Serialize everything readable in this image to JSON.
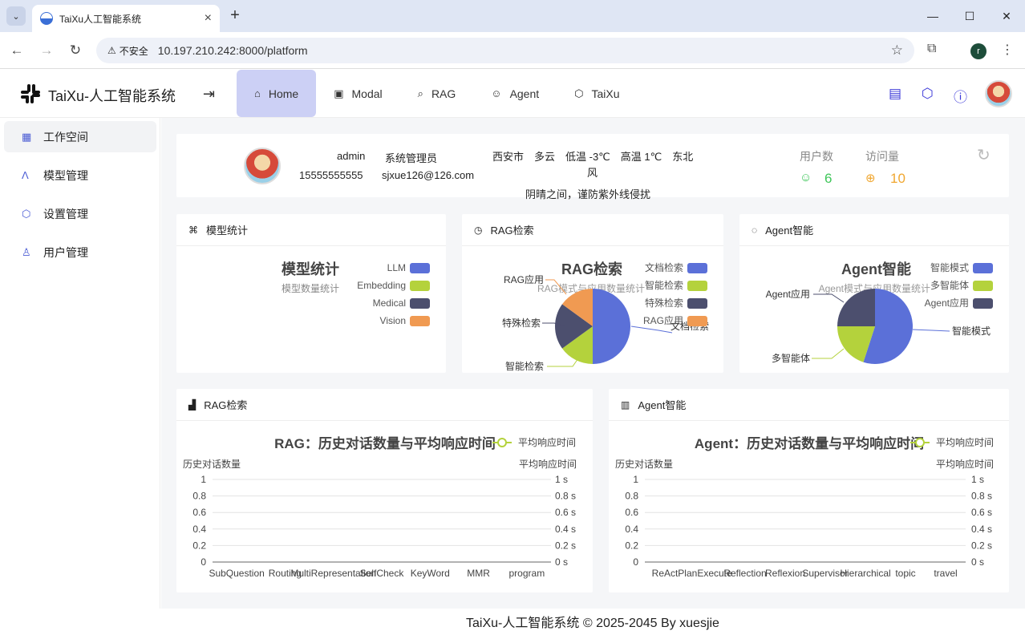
{
  "browser": {
    "tab_title": "TaiXu人工智能系统",
    "insecure_label": "不安全",
    "url": "10.197.210.242:8000/platform",
    "profile_initial": "r"
  },
  "header": {
    "brand": "TaiXu-人工智能系统",
    "nav": [
      {
        "label": "Home",
        "icon": "home-icon"
      },
      {
        "label": "Modal",
        "icon": "image-edit-icon"
      },
      {
        "label": "RAG",
        "icon": "search-doc-icon"
      },
      {
        "label": "Agent",
        "icon": "robot-icon"
      },
      {
        "label": "TaiXu",
        "icon": "cube-icon"
      }
    ]
  },
  "sidebar": {
    "items": [
      {
        "label": "工作空间",
        "icon": "workspace-icon"
      },
      {
        "label": "模型管理",
        "icon": "model-icon"
      },
      {
        "label": "设置管理",
        "icon": "settings-icon"
      },
      {
        "label": "用户管理",
        "icon": "user-icon"
      }
    ]
  },
  "user_card": {
    "name": "admin",
    "role": "系统管理员",
    "phone": "15555555555",
    "email": "sjxue126@126.com",
    "weather_line1": "西安市　多云　低温 -3℃　高温 1℃　东北",
    "weather_line2": "风",
    "weather_tip": "阴晴之间，谨防紫外线侵扰",
    "users_label": "用户数",
    "users_value": "6",
    "visits_label": "访问量",
    "visits_value": "10"
  },
  "model_card": {
    "header": "模型统计",
    "title": "模型统计",
    "subtitle": "模型数量统计",
    "legend": [
      "LLM",
      "Embedding",
      "Medical",
      "Vision"
    ]
  },
  "rag_card": {
    "header": "RAG检索",
    "title": "RAG检索",
    "subtitle": "RAG模式与应用数量统计",
    "legend": [
      "文档检索",
      "智能检索",
      "特殊检索",
      "RAG应用"
    ],
    "slice_labels": [
      "文档检索",
      "智能检索",
      "特殊检索",
      "RAG应用"
    ]
  },
  "agent_card": {
    "header": "Agent智能",
    "title": "Agent智能",
    "subtitle": "Agent模式与应用数量统计",
    "legend": [
      "智能模式",
      "多智能体",
      "Agent应用"
    ],
    "slice_labels": [
      "智能模式",
      "多智能体",
      "Agent应用"
    ]
  },
  "rag_line_card": {
    "header": "RAG检索",
    "title": "RAG：历史对话数量与平均响应时间",
    "legend": "平均响应时间",
    "left_axis": "历史对话数量",
    "right_axis": "平均响应时间",
    "left_ticks": [
      "1",
      "0.8",
      "0.6",
      "0.4",
      "0.2",
      "0"
    ],
    "right_ticks": [
      "1 s",
      "0.8 s",
      "0.6 s",
      "0.4 s",
      "0.2 s",
      "0 s"
    ],
    "x_labels": [
      "SubQuestion",
      "Routing",
      "MultiRepresentation",
      "SelfCheck",
      "KeyWord",
      "MMR",
      "program"
    ]
  },
  "agent_line_card": {
    "header": "Agent智能",
    "title": "Agent：历史对话数量与平均响应时间",
    "legend": "平均响应时间",
    "left_axis": "历史对话数量",
    "right_axis": "平均响应时间",
    "left_ticks": [
      "1",
      "0.8",
      "0.6",
      "0.4",
      "0.2",
      "0"
    ],
    "right_ticks": [
      "1 s",
      "0.8 s",
      "0.6 s",
      "0.4 s",
      "0.2 s",
      "0 s"
    ],
    "x_labels": [
      "ReAct",
      "PlanExecute",
      "Reflection",
      "Reflexion",
      "Supervisor",
      "Hierarchical",
      "topic",
      "travel"
    ]
  },
  "chart_data": [
    {
      "type": "pie",
      "title": "RAG检索",
      "categories": [
        "文档检索",
        "智能检索",
        "特殊检索",
        "RAG应用"
      ],
      "values": [
        50,
        15,
        20,
        15
      ]
    },
    {
      "type": "pie",
      "title": "Agent智能",
      "categories": [
        "智能模式",
        "多智能体",
        "Agent应用"
      ],
      "values": [
        55,
        20,
        25
      ]
    }
  ],
  "colors": {
    "blue": "#5b70d8",
    "green": "#b4d23c",
    "navy": "#4c4f6e",
    "orange": "#f09a52",
    "accent": "#3a37d8"
  },
  "footer": "TaiXu-人工智能系统 © 2025-2045 By xuesjie"
}
